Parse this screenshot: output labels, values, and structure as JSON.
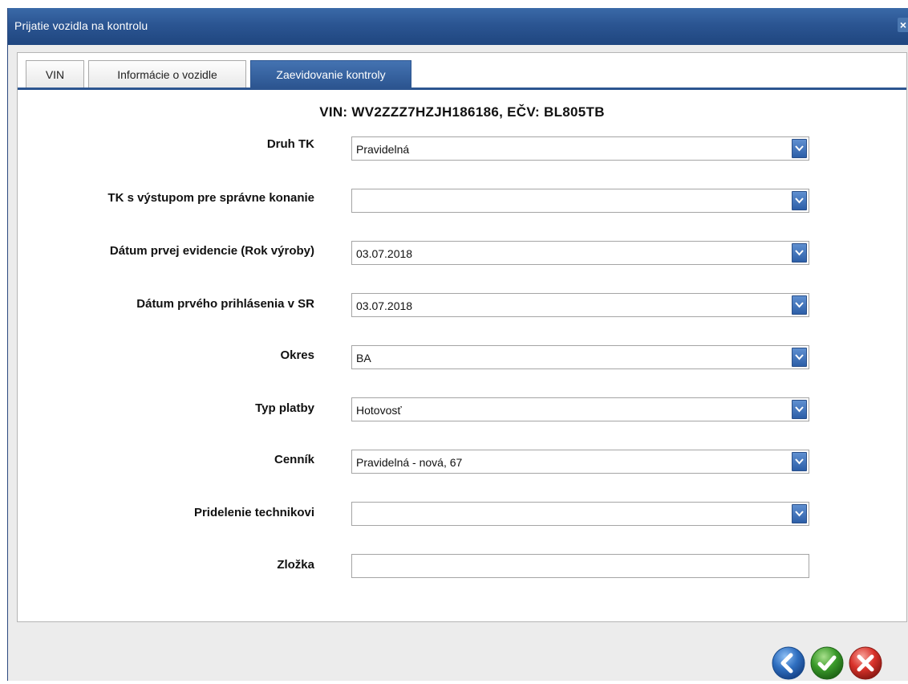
{
  "window": {
    "title": "Prijatie vozidla na kontrolu",
    "close_symbol": "×"
  },
  "tabs": [
    {
      "label": "VIN",
      "active": false
    },
    {
      "label": "Informácie o vozidle",
      "active": false
    },
    {
      "label": "Zaevidovanie kontroly",
      "active": true
    }
  ],
  "heading": "VIN: WV2ZZZ7HZJH186186, EČV: BL805TB",
  "form": {
    "druh_tk": {
      "label": "Druh TK",
      "value": "Pravidelná"
    },
    "tk_vystup": {
      "label": "TK s výstupom pre správne konanie",
      "value": ""
    },
    "datum_evidencie": {
      "label": "Dátum prvej evidencie (Rok výroby)",
      "value": "03.07.2018"
    },
    "datum_prihlasenia": {
      "label": "Dátum prvého prihlásenia v SR",
      "value": "03.07.2018"
    },
    "okres": {
      "label": "Okres",
      "value": "BA"
    },
    "typ_platby": {
      "label": "Typ platby",
      "value": "Hotovosť"
    },
    "cennik": {
      "label": "Cenník",
      "value": "Pravidelná - nová, 67"
    },
    "pridelenie": {
      "label": "Pridelenie technikovi",
      "value": ""
    },
    "zlozka": {
      "label": "Zložka",
      "value": ""
    }
  },
  "footer": {
    "back_icon": "chevron-left-icon",
    "confirm_icon": "check-icon",
    "cancel_icon": "x-icon"
  },
  "colors": {
    "titlebar": "#2b5592",
    "active_tab": "#2c5590",
    "back_button": "#2f6fc0",
    "confirm_button": "#3a9a2a",
    "cancel_button": "#d8322a"
  }
}
